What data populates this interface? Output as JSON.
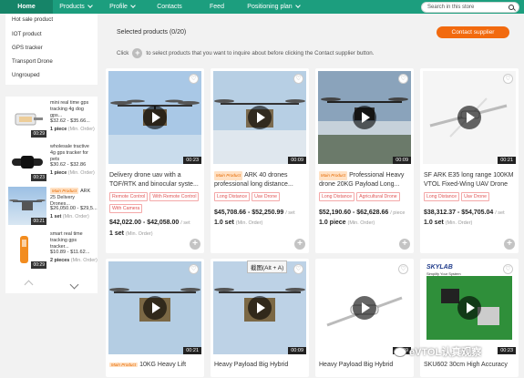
{
  "nav": {
    "items": [
      {
        "label": "Home",
        "active": true,
        "dropdown": false
      },
      {
        "label": "Products",
        "active": false,
        "dropdown": true
      },
      {
        "label": "Profile",
        "active": false,
        "dropdown": true
      },
      {
        "label": "Contacts",
        "active": false,
        "dropdown": false
      },
      {
        "label": "Feed",
        "active": false,
        "dropdown": false
      },
      {
        "label": "Positioning plan",
        "active": false,
        "dropdown": true
      }
    ],
    "search_placeholder": "Search in this store"
  },
  "categories": [
    "Hot sale product",
    "IOT product",
    "GPS tracker",
    "Transport Drone",
    "Ungrouped"
  ],
  "recommended": [
    {
      "title": "mini real time gps tracking 4g dog gps...",
      "price": "$32.62 - $35.66...",
      "moq": "1 piece",
      "moq_note": "(Min. Order)",
      "duration": "00:29",
      "main": false
    },
    {
      "title": "wholesale tractive 4g gps tracker for pets",
      "price": "$30.62 - $32.86",
      "moq": "1 piece",
      "moq_note": "(Min. Order)",
      "duration": "00:23",
      "main": false
    },
    {
      "title": "ARK 25 Delivery Drones...",
      "price": "$26,050.00 - $29,5...",
      "moq": "1 set",
      "moq_note": "(Min. Order)",
      "duration": "00:21",
      "main": true
    },
    {
      "title": "smart real time tracking gps tracker...",
      "price": "$10.89 - $11.62...",
      "moq": "2 pieces",
      "moq_note": "(Min. Order)",
      "duration": "00:29",
      "main": false
    }
  ],
  "main_badge": "Main Product",
  "selected": {
    "title": "Selected products (0/20)",
    "contact_button": "Contact supplier",
    "click_prefix": "Click",
    "click_suffix": "to select products that you want to inquire about before clicking the Contact supplier button."
  },
  "products": [
    {
      "title": "Delivery drone uav with a TOF/RTK and binocular syste...",
      "main": false,
      "tags": [
        "Remote Control",
        "With Remote Control",
        "With Camera"
      ],
      "price": "$42,022.00 - $42,058.00",
      "unit": "/ set",
      "moq": "1 set",
      "moq_note": "(Min. Order)",
      "duration": "00:23"
    },
    {
      "title": "ARK 40 drones professional long distance...",
      "main": true,
      "tags": [
        "Long Distance",
        "Uav Drone"
      ],
      "price": "$45,708.66 - $52,250.99",
      "unit": "/ set",
      "moq": "1.0 set",
      "moq_note": "(Min. Order)",
      "duration": "00:09"
    },
    {
      "title": "Professional Heavy drone 20KG Payload Long...",
      "main": true,
      "tags": [
        "Long Distance",
        "Agricultural Drone"
      ],
      "price": "$52,190.60 - $62,628.66",
      "unit": "/ piece",
      "moq": "1.0 piece",
      "moq_note": "(Min. Order)",
      "duration": "00:09"
    },
    {
      "title": "SF ARK E35 long range 100KM VTOL Fixed-Wing UAV Drone",
      "main": false,
      "tags": [
        "Long Distance",
        "Uav Drone"
      ],
      "price": "$38,312.37 - $54,705.04",
      "unit": "/ set",
      "moq": "1.0 set",
      "moq_note": "(Min. Order)",
      "duration": "00:21"
    }
  ],
  "products_row2": [
    {
      "title": "10KG Heavy Lift",
      "main": true,
      "duration": "00:21"
    },
    {
      "title": "Heavy Payload Big Hybrid",
      "main": false,
      "duration": "00:09"
    },
    {
      "title": "Heavy Payload Big Hybrid",
      "main": false,
      "duration": "00:09"
    },
    {
      "title": "SKU602 30cm High Accuracy",
      "main": false,
      "duration": "00:23"
    }
  ],
  "skylab_logo": "SKYLAB",
  "skylab_tagline": "Simplify Your System",
  "tooltip": "截图(Alt + A)",
  "watermark": "eVTOL认真观察"
}
